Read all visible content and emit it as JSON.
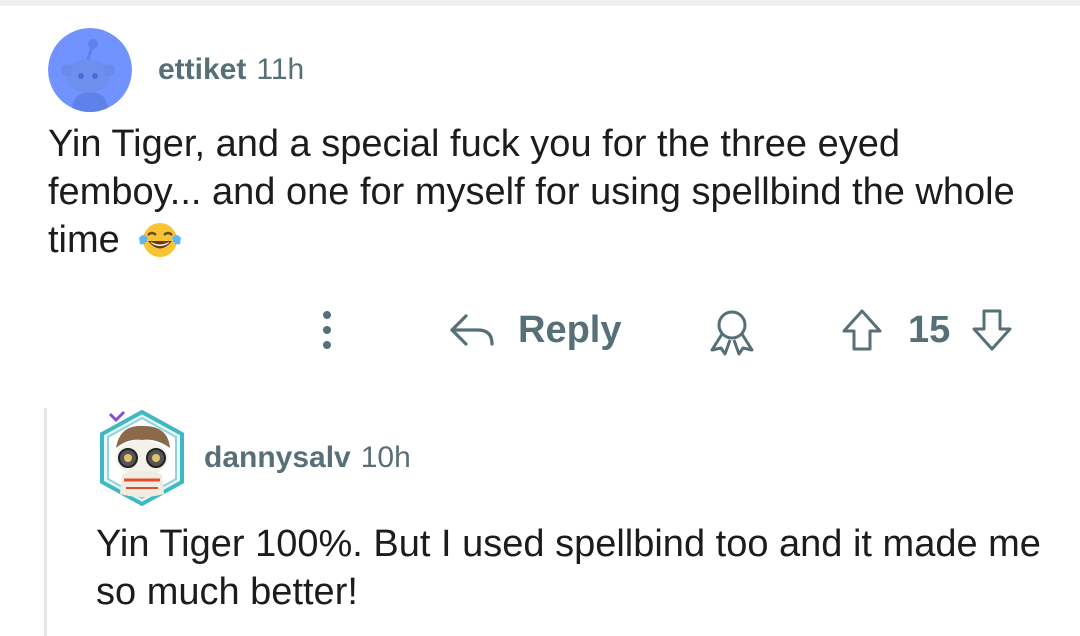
{
  "parent_comment": {
    "author": "ettiket",
    "time": "11h",
    "avatar_icon": "snoo-avatar-icon",
    "body": "Yin Tiger, and a special fuck you for the three eyed femboy... and one for myself for using spellbind the whole time",
    "emoji": "tears-of-joy-emoji"
  },
  "actions": {
    "more_icon": "vertical-ellipsis-icon",
    "reply_label": "Reply",
    "award_icon": "award-icon",
    "vote_count": "15"
  },
  "reply_comment": {
    "author": "dannysalv",
    "time": "10h",
    "avatar_icon": "custom-avatar-icon",
    "body": "Yin Tiger 100%. But I used spellbind too and it made me so much better!"
  },
  "colors": {
    "meta_text": "#576f76",
    "body_text": "#1c1c1c",
    "snoo_bg": "#7193ff",
    "thread_line": "#e3e6e8"
  }
}
